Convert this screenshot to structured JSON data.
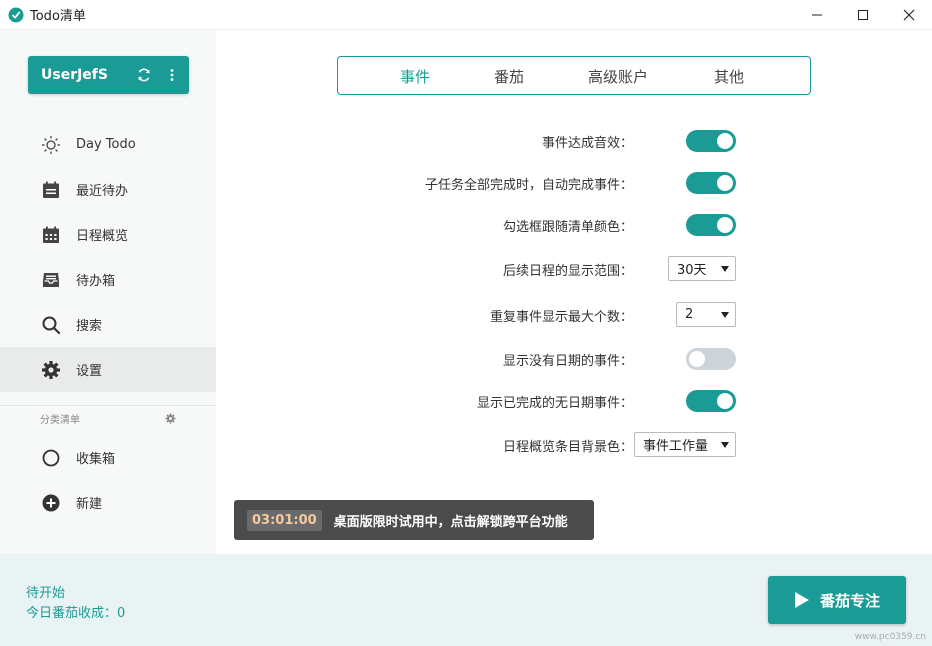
{
  "window": {
    "title": "Todo清单"
  },
  "sidebar": {
    "user": {
      "name": "UserJefS",
      "sync_icon": "sync-icon",
      "more_icon": "more-vertical-icon"
    },
    "items": [
      {
        "label": "Day Todo",
        "icon": "sun-icon"
      },
      {
        "label": "最近待办",
        "icon": "calendar-list-icon"
      },
      {
        "label": "日程概览",
        "icon": "calendar-grid-icon"
      },
      {
        "label": "待办箱",
        "icon": "inbox-icon"
      },
      {
        "label": "搜索",
        "icon": "search-icon"
      },
      {
        "label": "设置",
        "icon": "gear-icon",
        "active": true
      }
    ],
    "section": {
      "title": "分类清单",
      "icon": "gear-icon"
    },
    "lists": [
      {
        "label": "收集箱",
        "icon": "circle-icon"
      },
      {
        "label": "新建",
        "icon": "plus-circle-icon"
      }
    ]
  },
  "tabs": [
    {
      "label": "事件",
      "active": true
    },
    {
      "label": "番茄"
    },
    {
      "label": "高级账户"
    },
    {
      "label": "其他"
    }
  ],
  "settings": [
    {
      "label": "事件达成音效：",
      "type": "toggle",
      "on": true
    },
    {
      "label": "子任务全部完成时，自动完成事件：",
      "type": "toggle",
      "on": true
    },
    {
      "label": "勾选框跟随清单颜色：",
      "type": "toggle",
      "on": true
    },
    {
      "label": "后续日程的显示范围：",
      "type": "select",
      "value": "30天"
    },
    {
      "label": "重复事件显示最大个数：",
      "type": "select",
      "value": "2"
    },
    {
      "label": "显示没有日期的事件：",
      "type": "toggle",
      "on": false
    },
    {
      "label": "显示已完成的无日期事件：",
      "type": "toggle",
      "on": true
    },
    {
      "label": "日程概览条目背景色：",
      "type": "select",
      "value": "事件工作量"
    }
  ],
  "trial": {
    "timer": "03:01:00",
    "text": "桌面版限时试用中，点击解锁跨平台功能"
  },
  "footer": {
    "status": "待开始",
    "count": "今日番茄收成：0",
    "focus_label": "番茄专注"
  },
  "watermark": "www.pc0359.cn",
  "colors": {
    "accent": "#1b9b95",
    "toggle_off": "#ccd3d9",
    "sidebar_bg": "#f7f8f8",
    "footer_bg": "#eaf3f4",
    "trial_bg": "#4b4b4b",
    "timer_text": "#f4c9a0"
  }
}
